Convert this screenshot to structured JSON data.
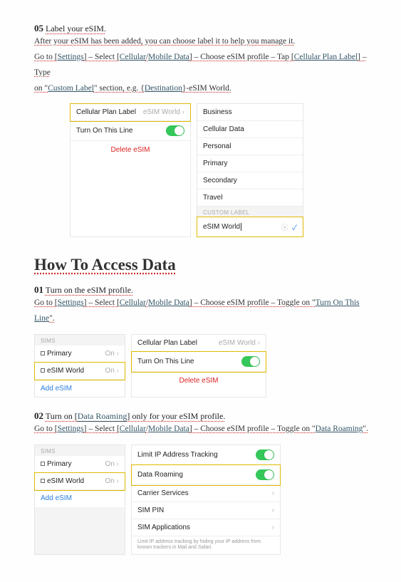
{
  "s05": {
    "num": "05",
    "title": "Label your eSIM.",
    "line1": "After your eSIM has been added, you can choose label it to help you manage it.",
    "line2_a": "Go to [",
    "link_settings": "Settings",
    "line2_b": "] – Select [",
    "link_cell": "Cellular",
    "line2_c": "/",
    "link_mobile": "Mobile Data",
    "line2_d": "] – Choose eSIM profile – Tap [",
    "link_cplabel": "Cellular Plan Label",
    "line2_e": "] – Type",
    "line3_a": "on \"",
    "link_custom": "Custom Label",
    "line3_b": "\" section, e.g. {",
    "link_dest": "Destination",
    "line3_c": "}-eSIM World.",
    "ui": {
      "cp_label": "Cellular Plan Label",
      "cp_value": "eSIM World",
      "turn_on": "Turn On This Line",
      "delete": "Delete eSIM",
      "opts": [
        "Business",
        "Cellular Data",
        "Personal",
        "Primary",
        "Secondary",
        "Travel"
      ],
      "custom_hdr": "CUSTOM LABEL",
      "custom_val": "eSIM World"
    }
  },
  "heading": "How To Access Data",
  "s01": {
    "num": "01",
    "title": "Turn on the eSIM profile.",
    "line_a": "Go to [",
    "link_settings": "Settings",
    "line_b": "] – Select [",
    "link_cell": "Cellular",
    "link_mobile": "Mobile Data",
    "line_c": "] – Choose eSIM profile – Toggle on \"",
    "link_turn": "Turn On This Line",
    "line_d": "\".",
    "ui": {
      "sims_hdr": "SIMs",
      "primary": "Primary",
      "on": "On",
      "esim": "eSIM World",
      "add": "Add eSIM",
      "cp_label": "Cellular Plan Label",
      "cp_value": "eSIM World",
      "turn_on": "Turn On This Line",
      "delete": "Delete eSIM"
    }
  },
  "s02": {
    "num": "02",
    "title_a": "Turn on [",
    "title_link": "Data Roaming",
    "title_b": "] only for your eSIM profile.",
    "line_a": "Go to [",
    "link_settings": "Settings",
    "line_b": "] – Select [",
    "link_cell": "Cellular",
    "link_mobile": "Mobile Data",
    "line_c": "] – Choose eSIM profile – Toggle on \"",
    "link_roam": "Data Roaming",
    "line_d": "\".",
    "ui": {
      "sims_hdr": "SIMs",
      "primary": "Primary",
      "on": "On",
      "esim": "eSIM World",
      "add": "Add eSIM",
      "limit_ip": "Limit IP Address Tracking",
      "roaming": "Data Roaming",
      "carrier": "Carrier Services",
      "simpin": "SIM PIN",
      "simapps": "SIM Applications",
      "fine": "Limit IP address tracking by hiding your IP address from known trackers in Mail and Safari."
    }
  }
}
